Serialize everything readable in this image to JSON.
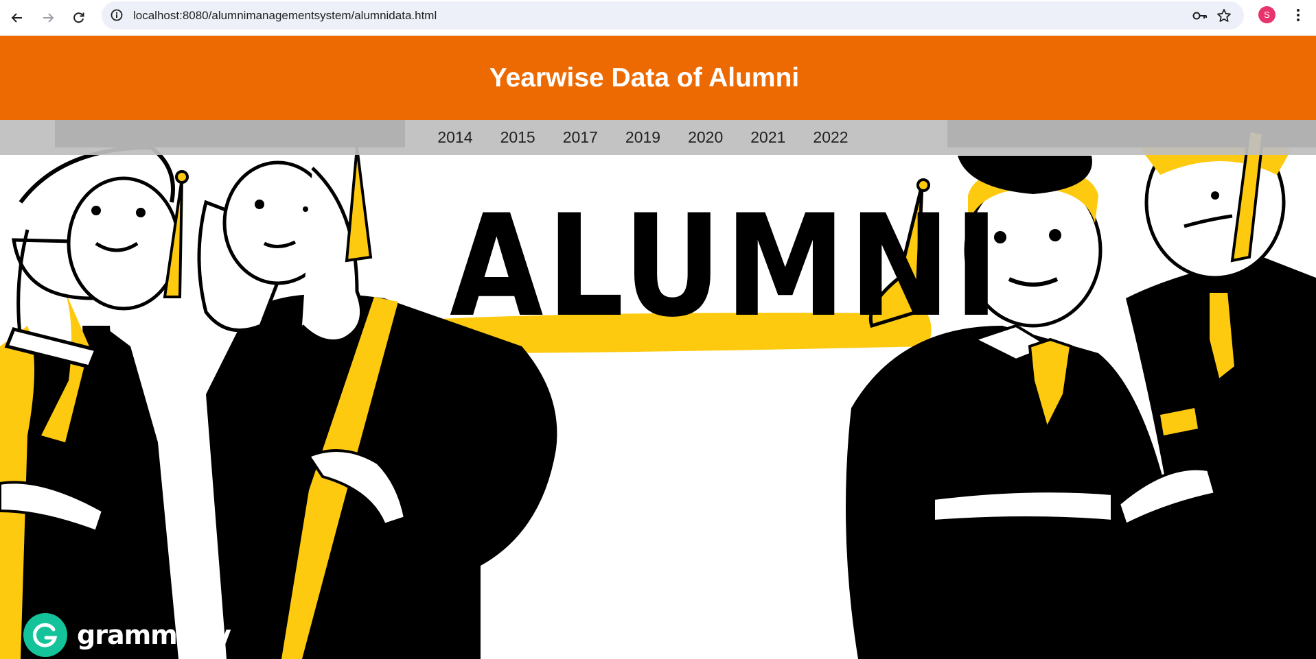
{
  "browser": {
    "url": "localhost:8080/alumnimanagementsystem/alumnidata.html",
    "profile_initial": "S",
    "colors": {
      "omnibox": "#edf0f8",
      "avatar": "#e8336d"
    },
    "icons": [
      "back-arrow-icon",
      "forward-arrow-icon",
      "reload-icon",
      "site-info-icon",
      "password-key-icon",
      "bookmark-star-icon",
      "kebab-menu-icon"
    ]
  },
  "header": {
    "title": "Yearwise Data of Alumni",
    "background": "#ed6a02"
  },
  "year_nav": {
    "years": [
      "2014",
      "2015",
      "2017",
      "2019",
      "2020",
      "2021",
      "2022"
    ]
  },
  "hero": {
    "headline": "ALUMNI",
    "accent": "#fdca0f"
  },
  "badge": {
    "brand": "grammarly",
    "color": "#15c39a"
  }
}
